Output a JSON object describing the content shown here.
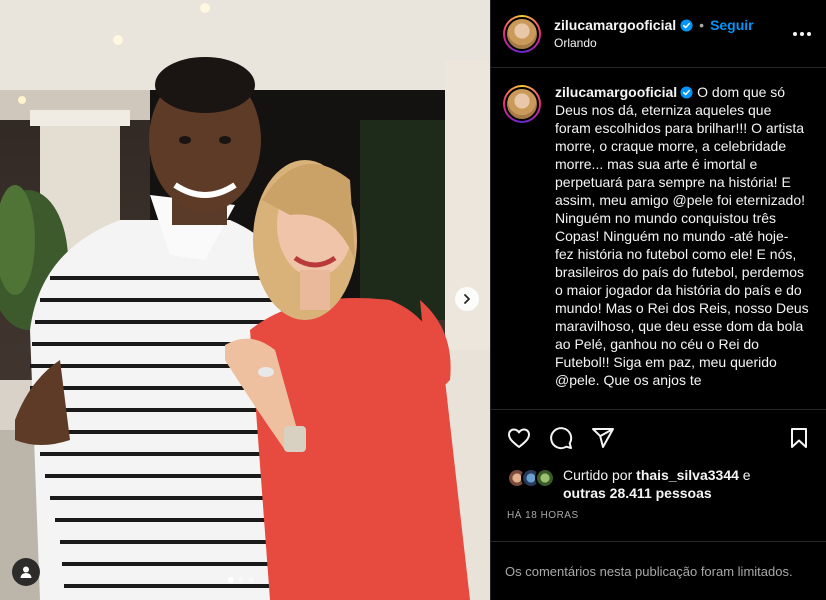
{
  "post": {
    "username": "zilucamargooficial",
    "location": "Orlando",
    "follow_label": "Seguir",
    "separator": "•",
    "caption": "O dom que só Deus nos dá, eterniza aqueles que foram escolhidos para brilhar!!! O artista morre, o craque morre, a celebridade morre... mas sua arte é imortal e perpetuará para sempre na história! E assim, meu amigo @pele foi eternizado! Ninguém no mundo conquistou três Copas! Ninguém no mundo -até hoje- fez história no futebol como ele! E nós, brasileiros do país do futebol, perdemos o maior jogador da história do país e do mundo! Mas o Rei dos Reis, nosso Deus maravilhoso, que deu esse dom da bola ao Pelé, ganhou no céu o Rei do Futebol!! Siga em paz, meu querido @pele. Que os anjos te",
    "likes": {
      "prefix": "Curtido por",
      "user": "thais_silva3344",
      "connector": "e",
      "others": "outras 28.411 pessoas"
    },
    "time_ago": "HÁ 18 HORAS",
    "comments_limited": "Os comentários nesta publicação foram limitados."
  },
  "carousel": {
    "count": 3,
    "active": 0
  },
  "icons": {
    "verified": "verified-badge-icon",
    "more": "more-options-icon",
    "like": "heart-icon",
    "comment": "comment-icon",
    "share": "share-icon",
    "save": "bookmark-icon",
    "next": "chevron-right-icon",
    "tag": "user-tag-icon"
  },
  "colors": {
    "accent": "#0095f6",
    "background": "#000000",
    "muted": "#a8a8a8",
    "verified": "#0095f6"
  }
}
